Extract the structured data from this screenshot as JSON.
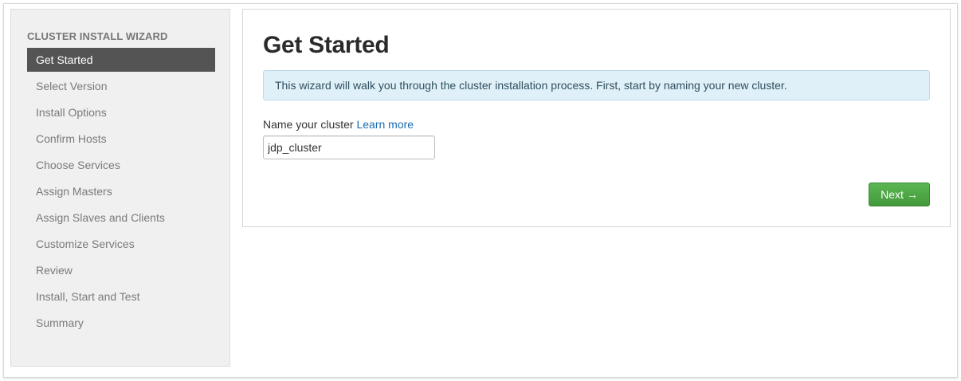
{
  "sidebar": {
    "heading": "CLUSTER INSTALL WIZARD",
    "active_index": 0,
    "items": [
      {
        "label": "Get Started"
      },
      {
        "label": "Select Version"
      },
      {
        "label": "Install Options"
      },
      {
        "label": "Confirm Hosts"
      },
      {
        "label": "Choose Services"
      },
      {
        "label": "Assign Masters"
      },
      {
        "label": "Assign Slaves and Clients"
      },
      {
        "label": "Customize Services"
      },
      {
        "label": "Review"
      },
      {
        "label": "Install, Start and Test"
      },
      {
        "label": "Summary"
      }
    ]
  },
  "main": {
    "title": "Get Started",
    "alert_text": "This wizard will walk you through the cluster installation process. First, start by naming your new cluster.",
    "name_label": "Name your cluster",
    "learn_more": "Learn more",
    "cluster_name_value": "jdp_cluster",
    "next_label": "Next",
    "next_arrow": "→"
  },
  "colors": {
    "active_nav_bg": "#545454",
    "alert_bg": "#dff0f8",
    "link": "#1a6bb0",
    "next_button": "#4aa441"
  },
  "icons": {
    "next": "arrow-right-icon"
  }
}
